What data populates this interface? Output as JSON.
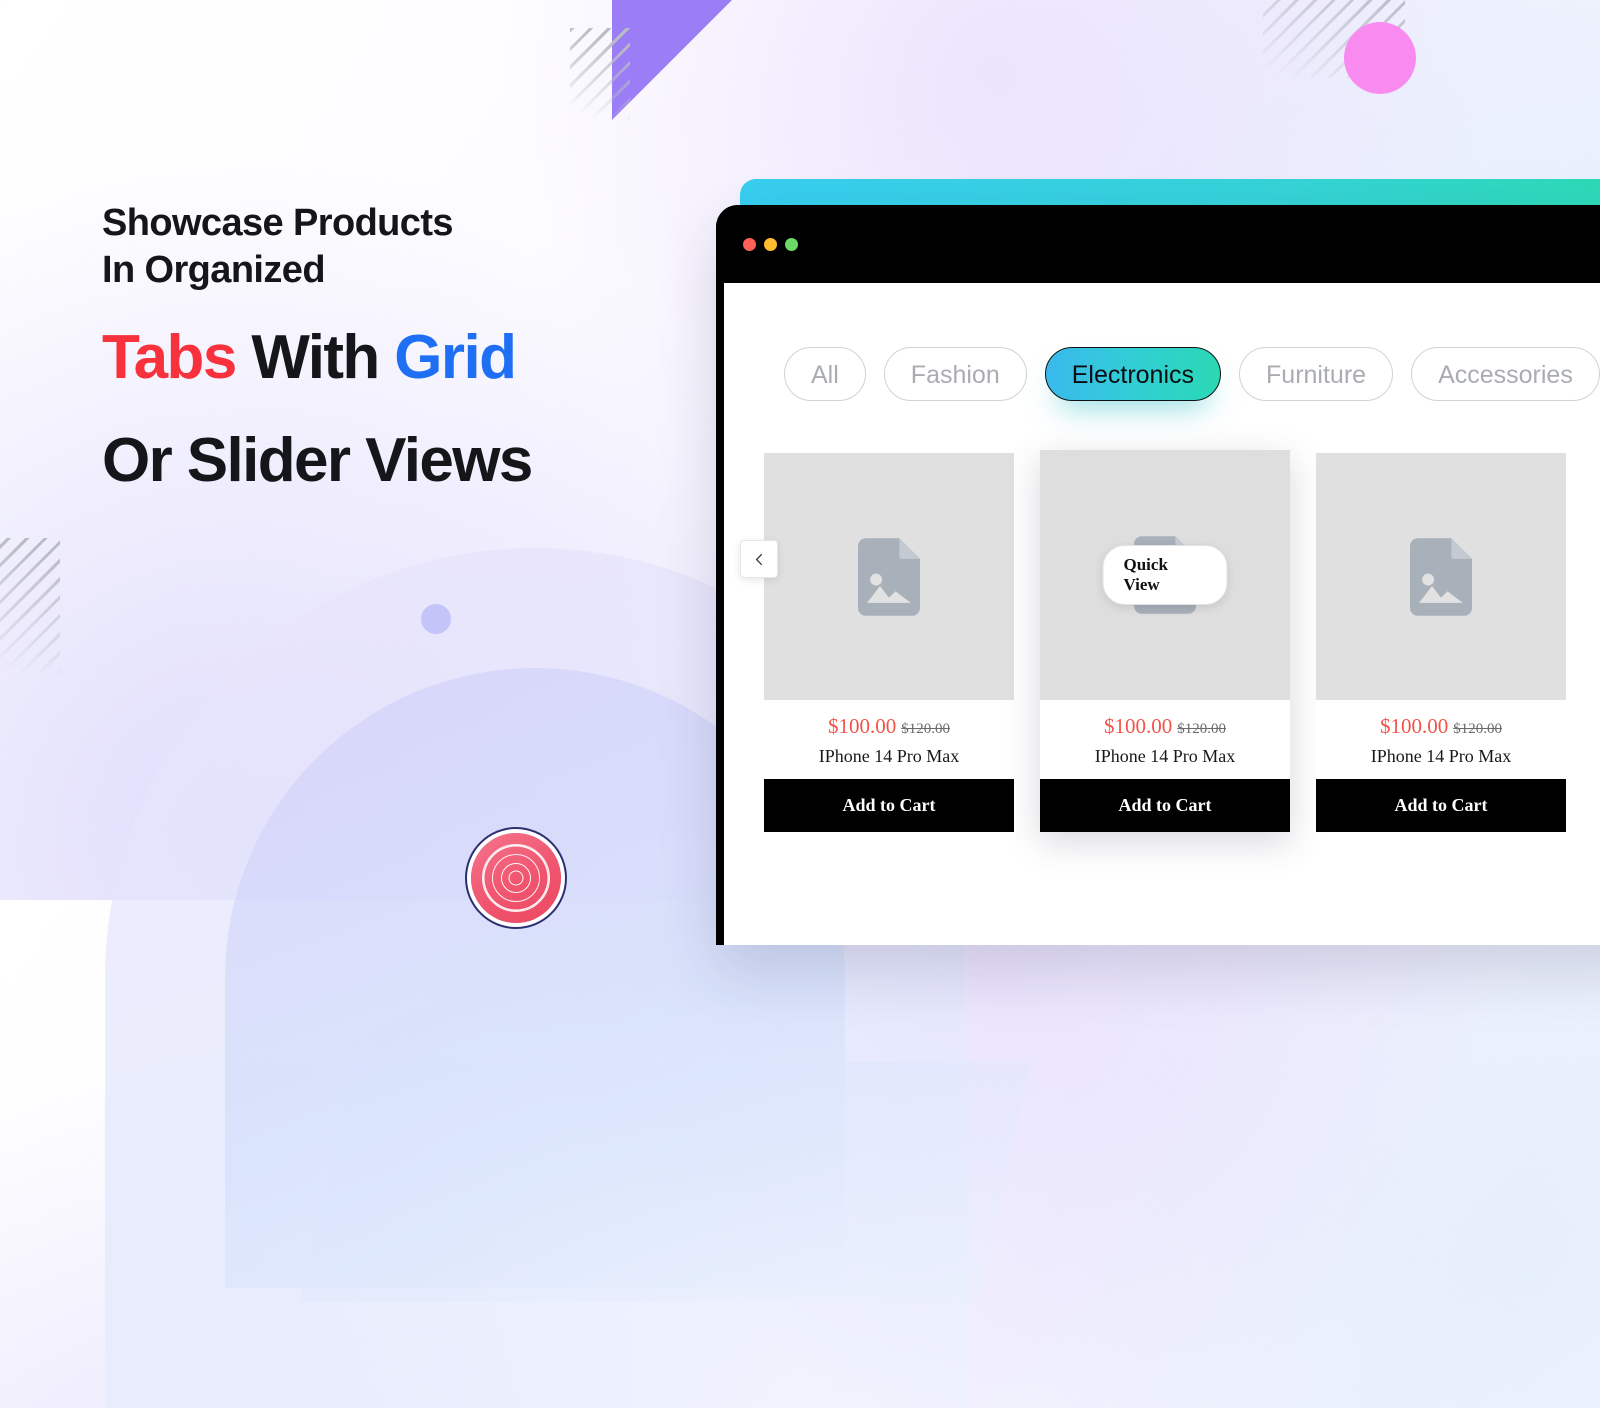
{
  "headline": {
    "line1": "Showcase Products",
    "line2": "In Organized",
    "line3_part1": "Tabs",
    "line3_part2": " With ",
    "line3_part3": "Grid",
    "line4": "Or Slider Views",
    "accent_red": "#f8323d",
    "accent_blue": "#1f6ff4"
  },
  "browser": {
    "traffic_lights": [
      "close-red",
      "minimize-yellow",
      "maximize-green"
    ],
    "accent_gradient_from": "#38cef0",
    "accent_gradient_to": "#2bdcab"
  },
  "tabs": [
    {
      "label": "All",
      "active": false
    },
    {
      "label": "Fashion",
      "active": false
    },
    {
      "label": "Electronics",
      "active": true
    },
    {
      "label": "Furniture",
      "active": false
    },
    {
      "label": "Accessories",
      "active": false
    }
  ],
  "slider": {
    "prev_icon": "chevron-left-icon"
  },
  "products": [
    {
      "image_placeholder": "image-placeholder-icon",
      "price": "$100.00",
      "old_price": "$120.00",
      "name": "IPhone 14 Pro Max",
      "cta": "Add to Cart",
      "quick_view": "",
      "hovered": false
    },
    {
      "image_placeholder": "image-placeholder-icon",
      "price": "$100.00",
      "old_price": "$120.00",
      "name": "IPhone 14 Pro Max",
      "cta": "Add to Cart",
      "quick_view": "Quick View",
      "hovered": true
    },
    {
      "image_placeholder": "image-placeholder-icon",
      "price": "$100.00",
      "old_price": "$120.00",
      "name": "IPhone 14 Pro Max",
      "cta": "Add to Cart",
      "quick_view": "",
      "hovered": false
    }
  ],
  "colors": {
    "price_now": "#f4544a",
    "price_old": "#6b6b6b",
    "decor_purple": "#9b7ef6",
    "decor_pink": "#f98bf0",
    "decor_periwinkle": "#c3c4f8",
    "decor_rose_badge": "#f0556f"
  }
}
